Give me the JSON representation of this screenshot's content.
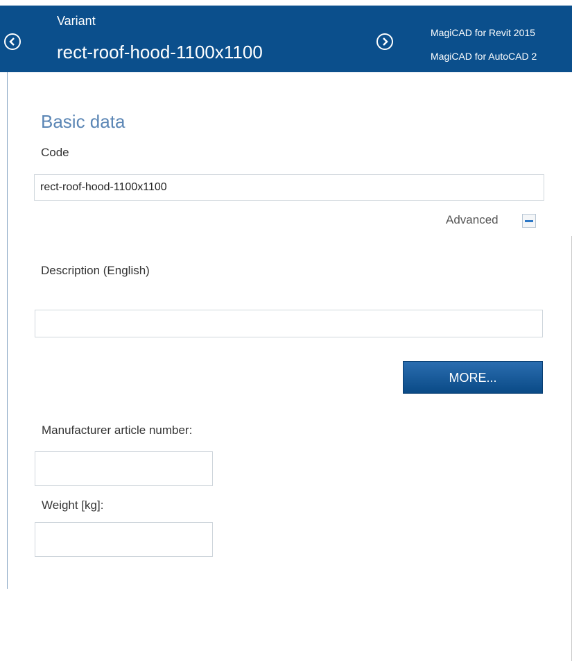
{
  "header": {
    "subtitle": "Variant",
    "title": "rect-roof-hood-1100x1100",
    "links": [
      "MagiCAD for Revit 2015",
      "MagiCAD for AutoCAD 2"
    ]
  },
  "form": {
    "section_title": "Basic data",
    "code_label": "Code",
    "code_value": "rect-roof-hood-1100x1100",
    "advanced_label": "Advanced",
    "description_label": "Description (English)",
    "description_value": "",
    "more_label": "MORE...",
    "article_label": "Manufacturer article number:",
    "article_value": "",
    "weight_label": "Weight [kg]:",
    "weight_value": ""
  },
  "colors": {
    "header_bg": "#0b4f8c",
    "section_title": "#5b86b5",
    "button_bg": "#1a5c9e"
  }
}
